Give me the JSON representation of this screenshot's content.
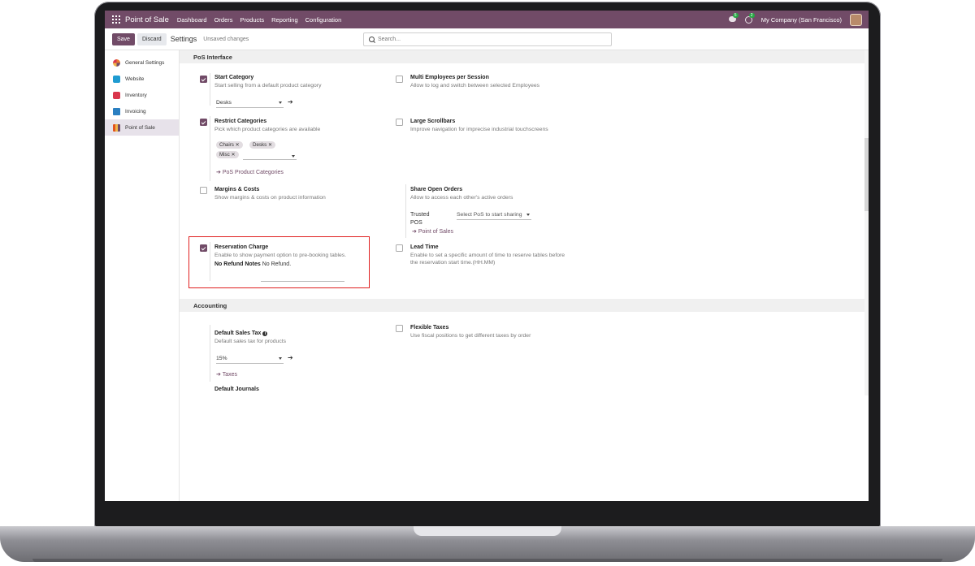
{
  "navbar": {
    "app_name": "Point of Sale",
    "menus": [
      "Dashboard",
      "Orders",
      "Products",
      "Reporting",
      "Configuration"
    ],
    "messages_count": "5",
    "activities_count": "2",
    "company": "My Company (San Francisco)"
  },
  "control_panel": {
    "save_label": "Save",
    "discard_label": "Discard",
    "title": "Settings",
    "status": "Unsaved changes",
    "search_placeholder": "Search..."
  },
  "sidebar": {
    "items": [
      {
        "label": "General Settings",
        "color": "#e8792f"
      },
      {
        "label": "Website",
        "color": "#1f9bd1"
      },
      {
        "label": "Inventory",
        "color": "#d9364c"
      },
      {
        "label": "Invoicing",
        "color": "#2a7fc1"
      },
      {
        "label": "Point of Sale",
        "color": "#e2531f"
      }
    ],
    "active": "Point of Sale"
  },
  "pos_interface": {
    "title": "PoS Interface",
    "start_category": {
      "title": "Start Category",
      "desc": "Start selling from a default product category",
      "checked": true,
      "value": "Desks"
    },
    "multi_employees": {
      "title": "Multi Employees per Session",
      "desc": "Allow to log and switch between selected Employees",
      "checked": false
    },
    "restrict_categories": {
      "title": "Restrict Categories",
      "desc": "Pick which product categories are available",
      "checked": true,
      "tags": [
        "Chairs",
        "Desks",
        "Misc"
      ],
      "link": "PoS Product Categories"
    },
    "large_scrollbars": {
      "title": "Large Scrollbars",
      "desc": "Improve navigation for imprecise industrial touchscreens",
      "checked": false
    },
    "margins_costs": {
      "title": "Margins & Costs",
      "desc": "Show margins & costs on product information",
      "checked": false
    },
    "share_open_orders": {
      "title": "Share Open Orders",
      "desc": "Allow to access each other's active orders",
      "trusted_label_1": "Trusted",
      "trusted_label_2": "POS",
      "select_placeholder": "Select PoS to start sharing",
      "link": "Point of Sales"
    },
    "reservation_charge": {
      "title": "Reservation Charge",
      "desc": "Enable to show payment option to pre-booking tables.",
      "checked": true,
      "notes_label": "No Refund Notes",
      "notes_value": "No Refund."
    },
    "lead_time": {
      "title": "Lead Time",
      "desc_1": "Enable to set a specific amount of time to reserve tables before",
      "desc_2": "the reservation start time.(HH.MM)",
      "checked": false
    }
  },
  "accounting": {
    "title": "Accounting",
    "default_sales_tax": {
      "title": "Default Sales Tax",
      "desc": "Default sales tax for products",
      "value": "15%",
      "link": "Taxes"
    },
    "flexible_taxes": {
      "title": "Flexible Taxes",
      "desc": "Use fiscal positions to get different taxes by order",
      "checked": false
    },
    "default_journals": {
      "title": "Default Journals"
    }
  },
  "colors": {
    "brand": "#714b67",
    "highlight": "#e02020"
  }
}
